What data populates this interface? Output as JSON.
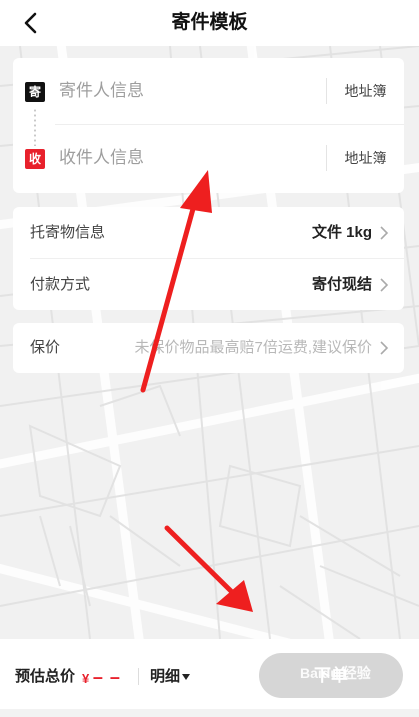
{
  "header": {
    "title": "寄件模板",
    "back_icon": "chevron-left-icon"
  },
  "address": {
    "sender_badge": "寄",
    "sender_placeholder": "寄件人信息",
    "sender_book": "地址簿",
    "receiver_badge": "收",
    "receiver_placeholder": "收件人信息",
    "receiver_book": "地址簿"
  },
  "goods": {
    "item_label": "托寄物信息",
    "item_value": "文件 1kg",
    "payment_label": "付款方式",
    "payment_value": "寄付现结"
  },
  "insurance": {
    "label": "保价",
    "hint": "未保价物品最高赔7倍运费,建议保价"
  },
  "footer": {
    "total_label": "预估总价",
    "currency": "¥",
    "amount": "– –",
    "detail_label": "明细",
    "submit_label": "下单",
    "watermark": "Baidu 经验"
  },
  "colors": {
    "accent": "#e8212c",
    "sender_badge": "#111111",
    "disabled_button": "#d6d6d6"
  }
}
